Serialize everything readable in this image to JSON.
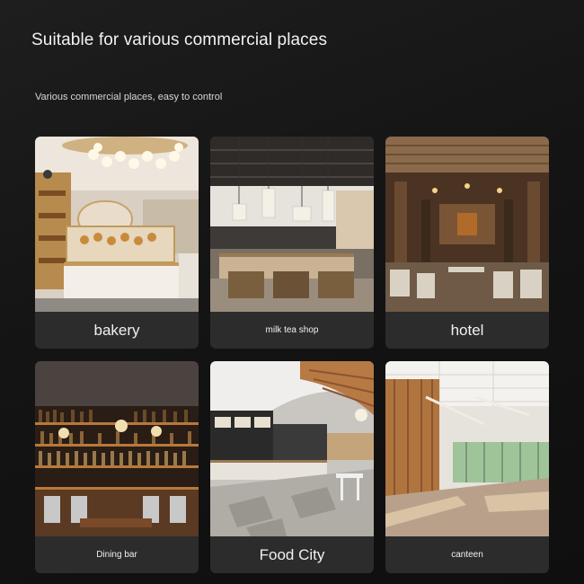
{
  "header": {
    "title": "Suitable for various commercial places",
    "subtitle": "Various commercial places, easy to control"
  },
  "cards": [
    {
      "label": "bakery",
      "photo": "bakery-interior-photo"
    },
    {
      "label": "milk tea shop",
      "photo": "milk-tea-shop-interior-photo"
    },
    {
      "label": "hotel",
      "photo": "hotel-hall-interior-photo"
    },
    {
      "label": "Dining bar",
      "photo": "dining-bar-interior-photo"
    },
    {
      "label": "Food City",
      "photo": "food-court-interior-photo"
    },
    {
      "label": "canteen",
      "photo": "canteen-interior-photo"
    }
  ]
}
